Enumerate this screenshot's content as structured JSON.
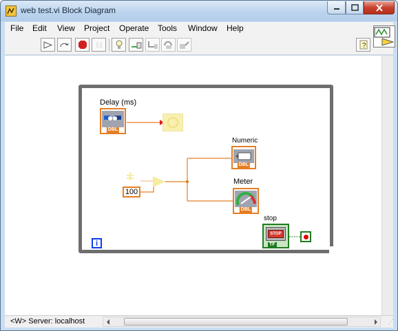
{
  "window": {
    "title": "web test.vi Block Diagram"
  },
  "menu": {
    "items": [
      "File",
      "Edit",
      "View",
      "Project",
      "Operate",
      "Tools",
      "Window",
      "Help"
    ]
  },
  "toolbar": {
    "buttons": [
      {
        "name": "run-arrow-icon"
      },
      {
        "name": "run-continuously-icon"
      },
      {
        "name": "abort-execution-icon"
      },
      {
        "name": "pause-icon"
      },
      {
        "name": "highlight-execution-icon"
      },
      {
        "name": "retain-wire-values-icon"
      },
      {
        "name": "step-into-icon"
      },
      {
        "name": "step-over-icon"
      },
      {
        "name": "step-out-icon"
      },
      {
        "name": "context-help-icon"
      }
    ]
  },
  "diagram": {
    "delay_label": "Delay (ms)",
    "numeric_label": "Numeric",
    "meter_label": "Meter",
    "stop_label": "stop",
    "constant_value": "100",
    "iteration_symbol": "i",
    "dbl_badge": "DBL",
    "stop_text": "STOP",
    "tf_badge": "TF",
    "colors": {
      "double_wire": "#e67e22",
      "boolean_wire": "#1f7a1f",
      "loop_frame": "#6e6e6e",
      "iteration_blue": "#0a3cf0"
    }
  },
  "status": {
    "server_text": "<W> Server: localhost"
  }
}
